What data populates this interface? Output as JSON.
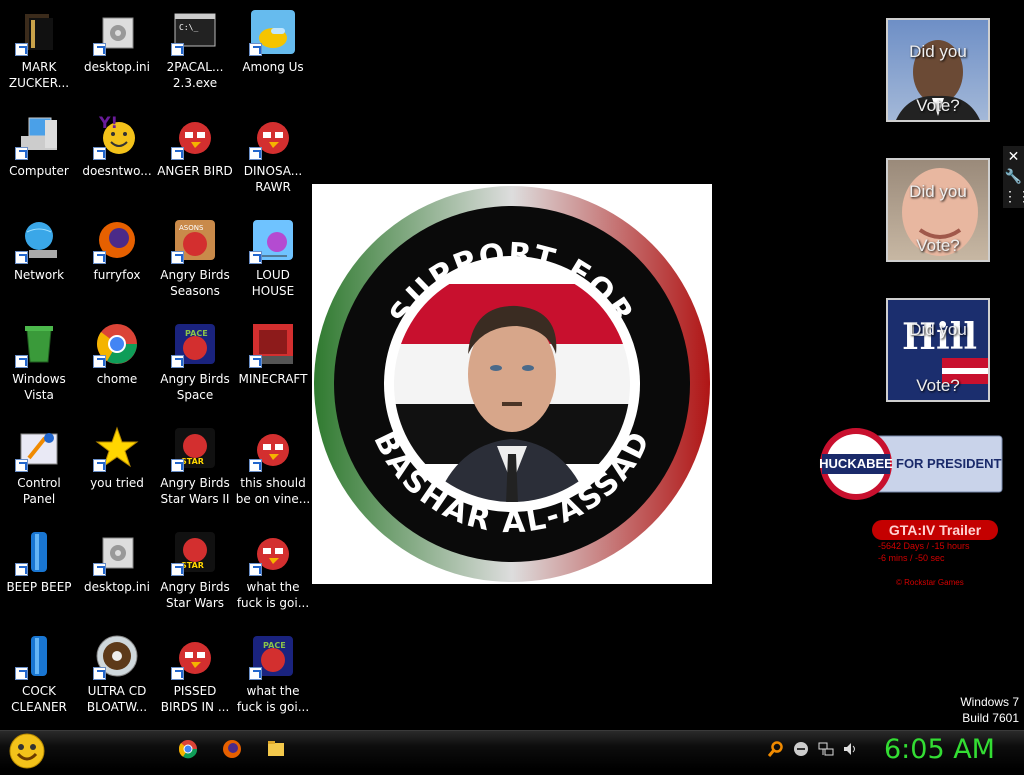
{
  "desktop": {
    "icons": [
      {
        "label": "MARK ZUCKER...",
        "icon": "book-icon"
      },
      {
        "label": "desktop.ini",
        "icon": "settings-file-icon"
      },
      {
        "label": "2PACAL... 2.3.exe",
        "icon": "console-icon"
      },
      {
        "label": "Among Us",
        "icon": "among-us-icon"
      },
      {
        "label": "Computer",
        "icon": "computer-icon"
      },
      {
        "label": "doesntwo...",
        "icon": "yahoo-messenger-icon"
      },
      {
        "label": "ANGER BIRD",
        "icon": "angry-bird-icon"
      },
      {
        "label": "DINOSA... RAWR",
        "icon": "angry-bird-icon"
      },
      {
        "label": "Network",
        "icon": "network-globe-icon"
      },
      {
        "label": "furryfox",
        "icon": "firefox-icon"
      },
      {
        "label": "Angry Birds Seasons",
        "icon": "angry-birds-seasons-icon"
      },
      {
        "label": "LOUD HOUSE",
        "icon": "loud-house-icon"
      },
      {
        "label": "Windows Vista",
        "icon": "recycle-bin-icon"
      },
      {
        "label": "chome",
        "icon": "chrome-icon"
      },
      {
        "label": "Angry Birds Space",
        "icon": "angry-birds-space-icon"
      },
      {
        "label": "MINECRAFT",
        "icon": "minecraft-icon"
      },
      {
        "label": "Control Panel",
        "icon": "control-panel-icon"
      },
      {
        "label": "you tried",
        "icon": "star-icon"
      },
      {
        "label": "Angry Birds Star Wars II",
        "icon": "angry-birds-star-wars-icon"
      },
      {
        "label": "this should be on vine...",
        "icon": "angry-bird-icon"
      },
      {
        "label": "BEEP BEEP",
        "icon": "blue-tube-icon"
      },
      {
        "label": "desktop.ini",
        "icon": "settings-file-icon"
      },
      {
        "label": "Angry Birds Star Wars",
        "icon": "angry-birds-star-wars-icon"
      },
      {
        "label": "what the fuck is goi...",
        "icon": "angry-bird-icon"
      },
      {
        "label": "COCK CLEANER",
        "icon": "blue-tube-icon"
      },
      {
        "label": "ULTRA CD BLOATW...",
        "icon": "cd-icon"
      },
      {
        "label": "PISSED BIRDS IN ...",
        "icon": "angry-bird-icon"
      },
      {
        "label": "what the fuck is goi...",
        "icon": "angry-birds-space-icon"
      }
    ]
  },
  "poster": {
    "top_text": "SUPPORT FOR",
    "bottom_text": "BASHAR AL-ASSAD"
  },
  "gadgets": {
    "obama_tile": {
      "line1": "Did you",
      "line2": "Vote?"
    },
    "mccain_tile": {
      "line1": "Did you",
      "line2": "Vote?"
    },
    "hill_tile": {
      "logo": "Hill",
      "line1": "Did you",
      "line2": "Vote?"
    },
    "huckabee": {
      "name": "HUCKABEE",
      "tagline": "FOR PRESIDENT"
    },
    "gta": {
      "title": "GTA:IV Trailer",
      "line1": "-5642 Days / -15 hours",
      "line2": "-6 mins / -50 sec",
      "copyright": "© Rockstar Games"
    },
    "controls": [
      "close-icon",
      "wrench-icon",
      "grip-icon"
    ]
  },
  "watermark": {
    "os": "Windows 7",
    "build": "Build 7601"
  },
  "taskbar": {
    "start_icon": "smiley-start-icon",
    "pinned": [
      "chrome-icon",
      "firefox-icon",
      "folder-icon"
    ],
    "tray": [
      "search-icon",
      "volume-mixer-icon",
      "network-icon",
      "speaker-icon"
    ],
    "clock": "6:05 AM"
  },
  "colors": {
    "clock": "#33dd33",
    "gta_red": "#c40000"
  }
}
